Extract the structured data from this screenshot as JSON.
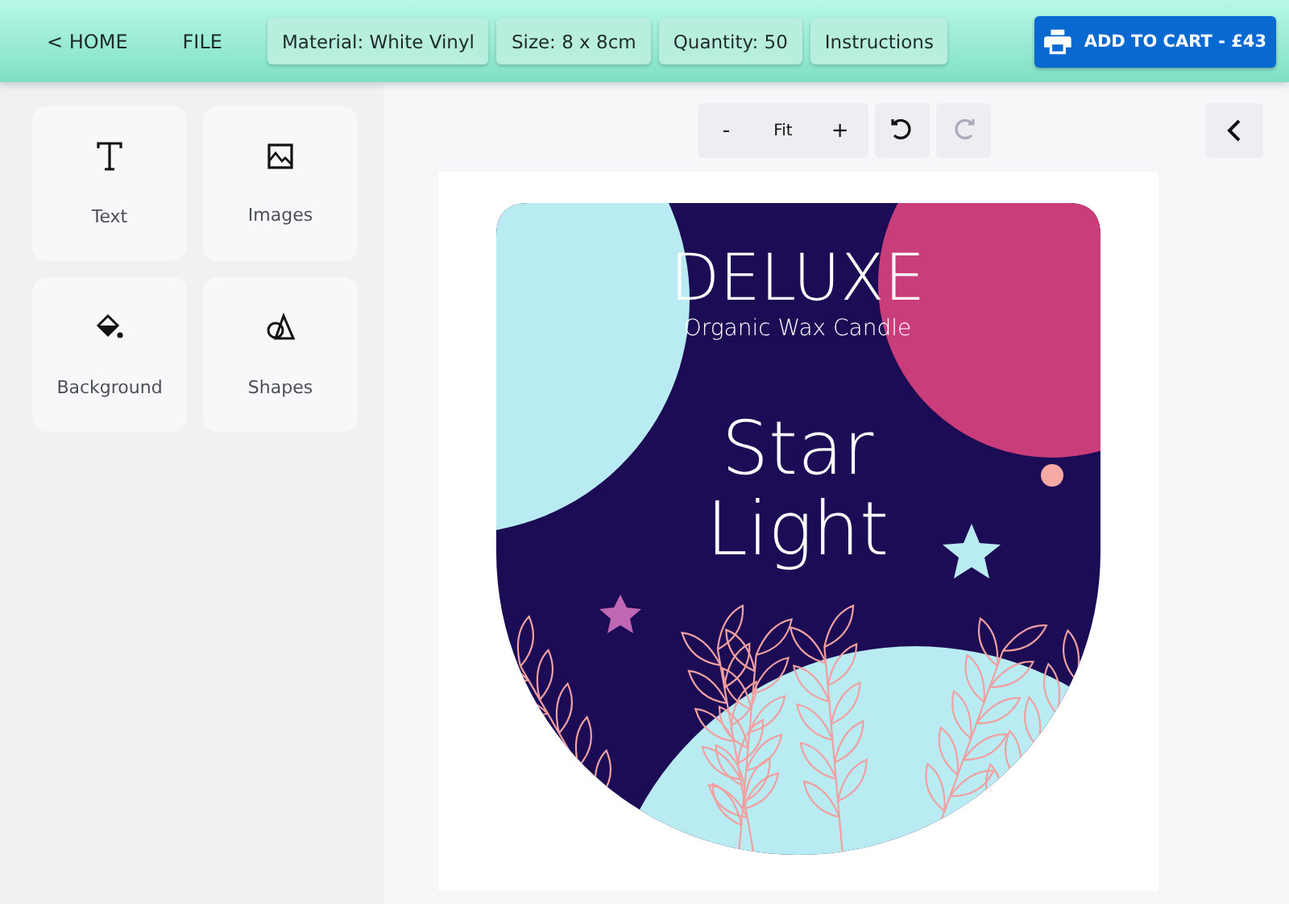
{
  "top_bar": {
    "home": "< HOME",
    "file": "FILE",
    "options": [
      {
        "label": "Material: White Vinyl"
      },
      {
        "label": "Size: 8 x 8cm"
      },
      {
        "label": "Quantity: 50"
      },
      {
        "label": "Instructions"
      }
    ],
    "cart_button": "ADD TO CART - £43"
  },
  "sidebar": {
    "tools": [
      {
        "kind": "text",
        "label": "Text"
      },
      {
        "kind": "images",
        "label": "Images"
      },
      {
        "kind": "background",
        "label": "Background"
      },
      {
        "kind": "shapes",
        "label": "Shapes"
      }
    ]
  },
  "toolbar": {
    "zoom_out": "-",
    "zoom_fit": "Fit",
    "zoom_in": "+",
    "history": [
      {
        "kind": "undo",
        "disabled": false
      },
      {
        "kind": "redo",
        "disabled": true
      }
    ]
  },
  "label": {
    "title": "DELUXE",
    "subtitle": "Organic Wax Candle",
    "name_lines": [
      "Star",
      "Light"
    ]
  }
}
